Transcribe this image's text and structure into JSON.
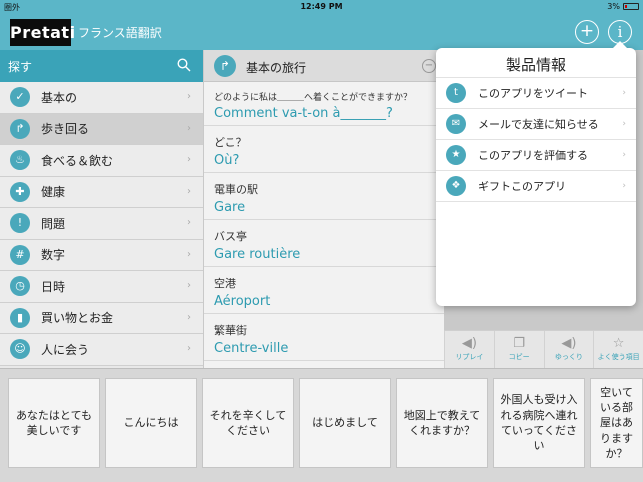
{
  "status_bar": {
    "carrier": "圏外",
    "time": "12:49 PM",
    "battery": "3%"
  },
  "header": {
    "logo": "Pretati",
    "title": "フランス語翻訳",
    "add_icon": "plus-circle-icon",
    "info_icon": "info-circle-icon"
  },
  "sidebar": {
    "search_label": "探す",
    "items": [
      {
        "label": "基本の",
        "icon": "basics-icon",
        "selected": false
      },
      {
        "label": "歩き回る",
        "icon": "directions-icon",
        "selected": true
      },
      {
        "label": "食べる＆飲む",
        "icon": "food-icon",
        "selected": false
      },
      {
        "label": "健康",
        "icon": "health-icon",
        "selected": false
      },
      {
        "label": "問題",
        "icon": "problem-icon",
        "selected": false
      },
      {
        "label": "数字",
        "icon": "numbers-icon",
        "selected": false
      },
      {
        "label": "日時",
        "icon": "clock-icon",
        "selected": false
      },
      {
        "label": "買い物とお金",
        "icon": "shopping-icon",
        "selected": false
      },
      {
        "label": "人に会う",
        "icon": "people-icon",
        "selected": false
      }
    ]
  },
  "phrase_panel": {
    "title": "基本の旅行",
    "phrases": [
      {
        "jp": "どのように私は＿＿＿へ着くことができますか？",
        "fr": "Comment va-t-on à_______?"
      },
      {
        "jp": "どこ？",
        "fr": "Où?"
      },
      {
        "jp": "電車の駅",
        "fr": "Gare"
      },
      {
        "jp": "バス亭",
        "fr": "Gare routière"
      },
      {
        "jp": "空港",
        "fr": "Aéroport"
      },
      {
        "jp": "繁華街",
        "fr": "Centre-ville"
      }
    ]
  },
  "toolbar": {
    "buttons": [
      {
        "label": "リプレイ",
        "icon": "speaker-icon"
      },
      {
        "label": "コピー",
        "icon": "copy-icon"
      },
      {
        "label": "ゆっくり",
        "icon": "slow-speaker-icon"
      },
      {
        "label": "よく使う項目",
        "icon": "star-icon"
      }
    ]
  },
  "popover": {
    "title": "製品情報",
    "items": [
      {
        "label": "このアプリをツイート",
        "icon": "twitter-icon"
      },
      {
        "label": "メールで友達に知らせる",
        "icon": "mail-icon"
      },
      {
        "label": "このアプリを評価する",
        "icon": "star-icon"
      },
      {
        "label": "ギフトこのアプリ",
        "icon": "gift-icon"
      }
    ]
  },
  "cards": [
    "あなたはとても美しいです",
    "こんにちは",
    "それを辛くしてください",
    "はじめまして",
    "地図上で教えてくれますか？",
    "外国人も受け入れる病院へ連れていってください",
    "空いている部屋はありますか？"
  ]
}
